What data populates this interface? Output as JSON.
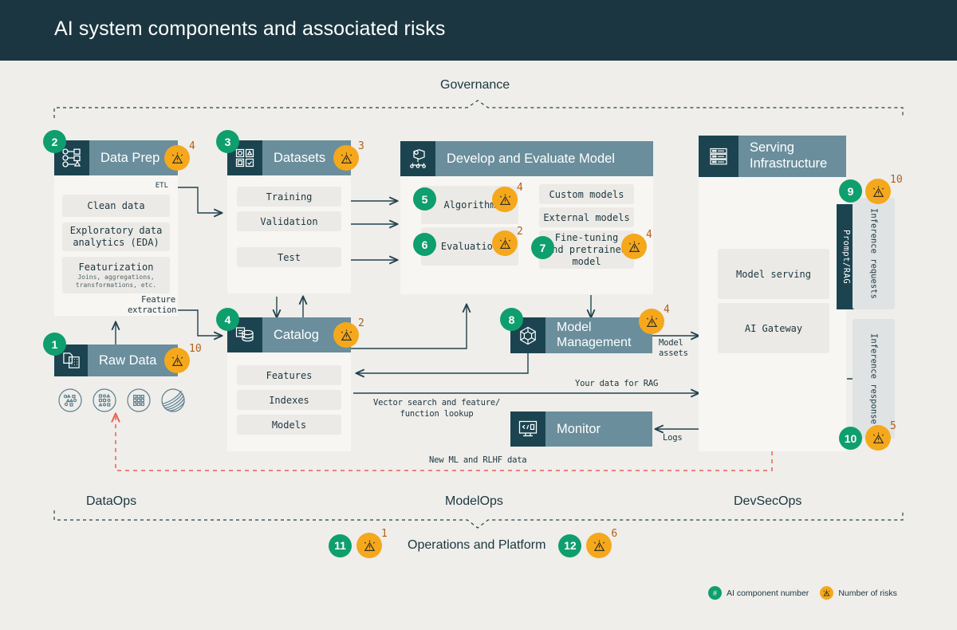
{
  "header": {
    "title": "AI system components and associated risks"
  },
  "governance": {
    "label": "Governance"
  },
  "components": {
    "raw_data": {
      "title": "Raw Data",
      "number": "1",
      "risks": "10",
      "icon": "document-grid-icon"
    },
    "data_prep": {
      "title": "Data Prep",
      "number": "2",
      "risks": "4",
      "icon": "workflow-nodes-icon",
      "items": [
        {
          "label": "Clean data",
          "sub": ""
        },
        {
          "label": "Exploratory data\nanalytics (EDA)",
          "sub": ""
        },
        {
          "label": "Featurization",
          "sub": "Joins, aggregations,\ntransformations, etc."
        }
      ],
      "edge_top": "ETL",
      "edge_bottom": "Feature\nextraction"
    },
    "datasets": {
      "title": "Datasets",
      "number": "3",
      "risks": "3",
      "icon": "shapes-grid-icon",
      "items": [
        "Training",
        "Validation",
        "Test"
      ]
    },
    "catalog": {
      "title": "Catalog",
      "number": "4",
      "risks": "2",
      "icon": "database-stack-icon",
      "items": [
        "Features",
        "Indexes",
        "Models"
      ]
    },
    "develop": {
      "title": "Develop and Evaluate Model",
      "icon": "model-graph-icon",
      "algorithm": {
        "label": "Algorithm",
        "number": "5",
        "risks": "4"
      },
      "evaluation": {
        "label": "Evaluation",
        "number": "6",
        "risks": "2"
      },
      "custom_models": "Custom models",
      "external_models": "External models",
      "fine_tuning": {
        "label": "Fine-tuning\nand pretrained\nmodel",
        "number": "7",
        "risks": "4"
      }
    },
    "model_mgmt": {
      "title": "Model\nManagement",
      "number": "8",
      "risks": "4",
      "icon": "cube-network-icon"
    },
    "monitor": {
      "title": "Monitor",
      "icon": "monitor-code-icon"
    },
    "serving": {
      "title": "Serving\nInfrastructure",
      "icon": "server-rack-icon",
      "items": [
        "Model serving",
        "AI Gateway"
      ],
      "prompt_rag": {
        "label": "Prompt/RAG",
        "number": "9",
        "risks": "10"
      },
      "inference_requests": "Inference requests",
      "inference_response": {
        "label": "Inference response",
        "number": "10",
        "risks": "5"
      }
    }
  },
  "flow_labels": {
    "model_assets": "Model\nassets",
    "your_data_for_rag": "Your data for RAG",
    "vector_search": "Vector search and feature/\nfunction lookup",
    "logs": "Logs",
    "new_ml_rlhf": "New ML and RLHF data"
  },
  "ops": {
    "dataops": "DataOps",
    "modelops": "ModelOps",
    "devsecops": "DevSecOps",
    "platform": {
      "label": "Operations and Platform",
      "left": {
        "number": "11",
        "risks": "1"
      },
      "right": {
        "number": "12",
        "risks": "6"
      }
    }
  },
  "legend": {
    "component_symbol": "#",
    "component_text": "AI component number",
    "risk_text": "Number of risks"
  },
  "colors": {
    "header_bg": "#1b3640",
    "panel_head": "#6a8e9c",
    "panel_icon": "#1b4450",
    "badge_green": "#0f9e6e",
    "badge_amber": "#f5a81c",
    "risk_count": "#b3601a",
    "page_bg": "#efeeea",
    "dashed_red": "#e8604c"
  }
}
